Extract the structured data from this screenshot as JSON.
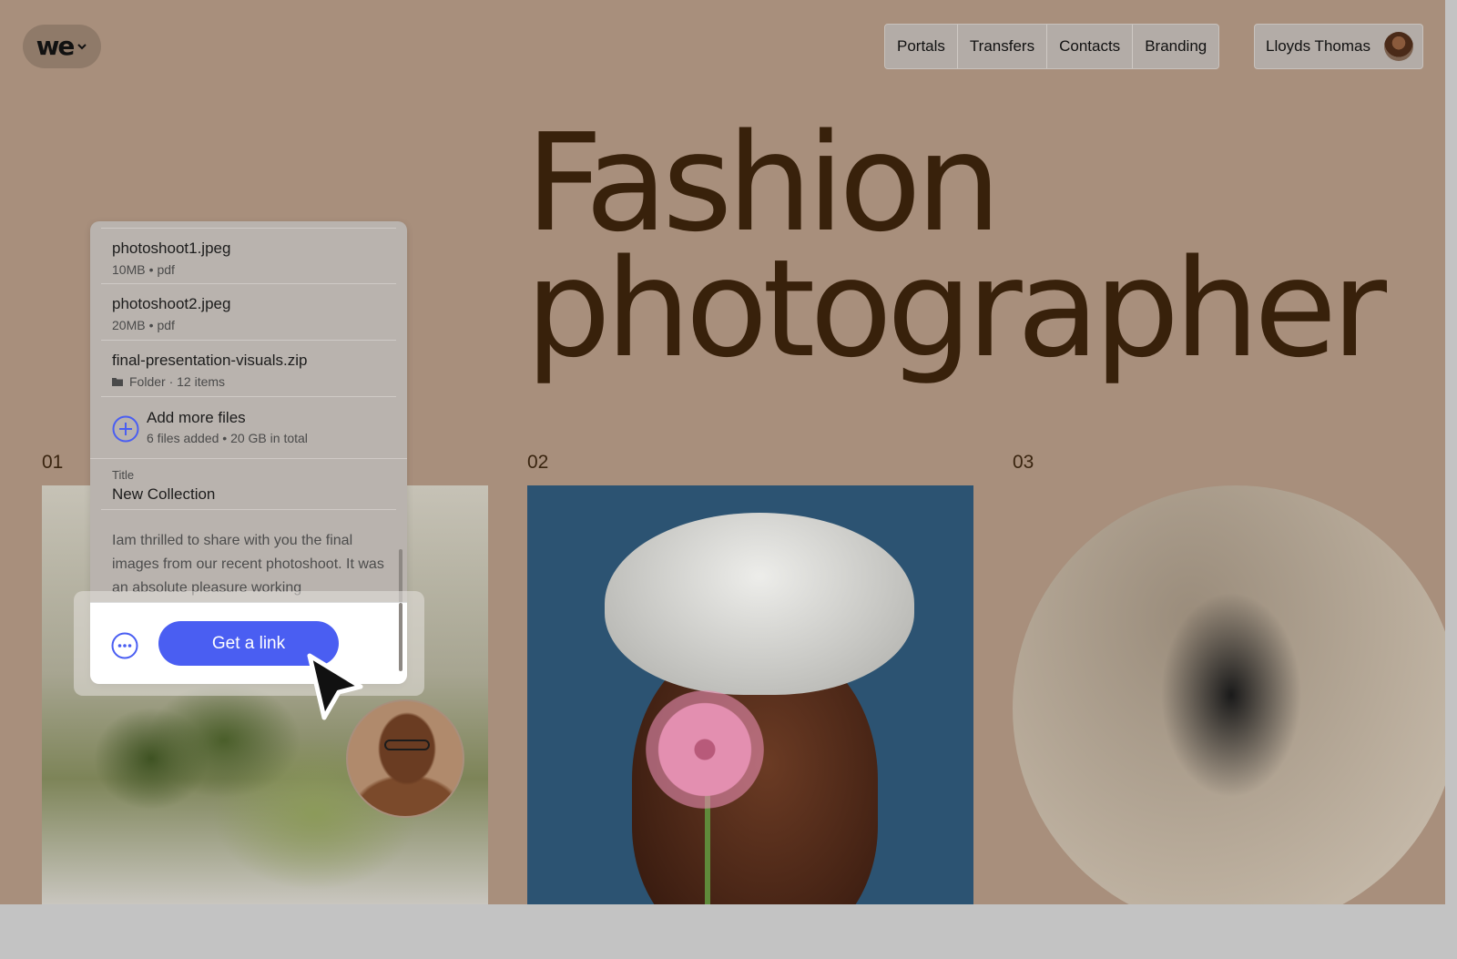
{
  "logo": {
    "text": "we"
  },
  "nav": {
    "items": [
      "Portals",
      "Transfers",
      "Contacts",
      "Branding"
    ],
    "user_name": "Lloyds Thomas"
  },
  "hero": {
    "line1": "Fashion",
    "line2": "photographer"
  },
  "gallery": {
    "numbers": [
      "01",
      "02",
      "03"
    ]
  },
  "upload_card": {
    "files": [
      {
        "name": "photoshoot1.jpeg",
        "size": "10MB",
        "type": "pdf"
      },
      {
        "name": "photoshoot2.jpeg",
        "size": "20MB",
        "type": "pdf"
      },
      {
        "name": "final-presentation-visuals.zip",
        "meta": "Folder · 12 items"
      }
    ],
    "add_more": {
      "title": "Add more files",
      "summary": "6 files added • 20 GB in total"
    },
    "title_field": {
      "label": "Title",
      "value": "New Collection"
    },
    "message": "Iam thrilled to share with you the final images from our recent photoshoot. It was an absolute pleasure working",
    "get_link_label": "Get a link"
  },
  "colors": {
    "page_background": "#a88f7c",
    "hero_text": "#38210b",
    "accent_button": "#4a5ef2",
    "panel_blue": "#2c5372"
  },
  "icons": [
    "chevron-down-icon",
    "folder-icon",
    "plus-circle-icon",
    "more-options-icon",
    "cursor-icon"
  ]
}
